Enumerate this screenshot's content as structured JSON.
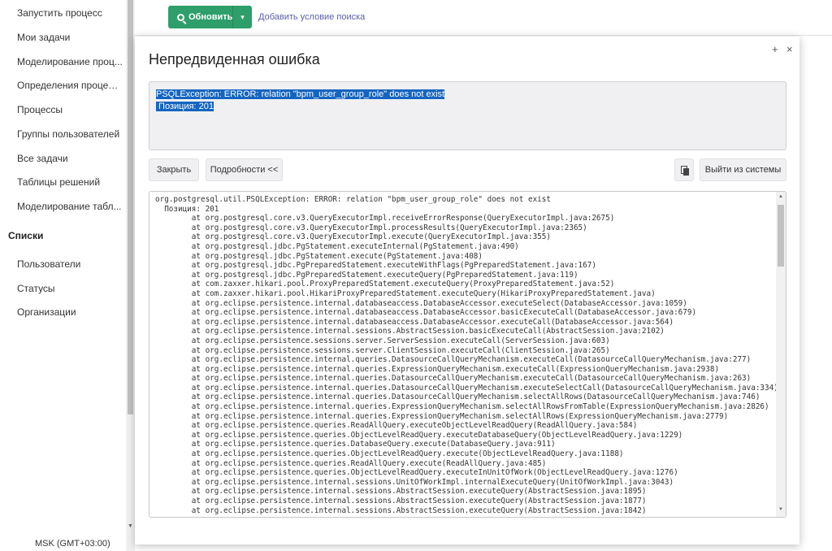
{
  "sidebar": {
    "items": [
      "Запустить процесс",
      "Мои задачи",
      "Моделирование проц...",
      "Определения процесс...",
      "Процессы",
      "Группы пользователей",
      "Все задачи",
      "Таблицы решений",
      "Моделирование табл..."
    ],
    "section": "Списки",
    "list_items": [
      "Пользователи",
      "Статусы",
      "Организации"
    ],
    "timezone": "MSK (GMT+03:00)"
  },
  "toolbar": {
    "refresh_label": "Обновить",
    "add_condition": "Добавить условие поиска"
  },
  "modal": {
    "title": "Непредвиденная ошибка",
    "maximize": "+",
    "close": "×",
    "message_line1": "PSQLException: ERROR: relation \"bpm_user_group_role\" does not exist",
    "message_line2": " Позиция: 201",
    "close_button": "Закрыть",
    "details_button": "Подробности <<",
    "logout_button": "Выйти из системы",
    "stacktrace": "org.postgresql.util.PSQLException: ERROR: relation \"bpm_user_group_role\" does not exist\n  Позиция: 201\n\tat org.postgresql.core.v3.QueryExecutorImpl.receiveErrorResponse(QueryExecutorImpl.java:2675)\n\tat org.postgresql.core.v3.QueryExecutorImpl.processResults(QueryExecutorImpl.java:2365)\n\tat org.postgresql.core.v3.QueryExecutorImpl.execute(QueryExecutorImpl.java:355)\n\tat org.postgresql.jdbc.PgStatement.executeInternal(PgStatement.java:490)\n\tat org.postgresql.jdbc.PgStatement.execute(PgStatement.java:408)\n\tat org.postgresql.jdbc.PgPreparedStatement.executeWithFlags(PgPreparedStatement.java:167)\n\tat org.postgresql.jdbc.PgPreparedStatement.executeQuery(PgPreparedStatement.java:119)\n\tat com.zaxxer.hikari.pool.ProxyPreparedStatement.executeQuery(ProxyPreparedStatement.java:52)\n\tat com.zaxxer.hikari.pool.HikariProxyPreparedStatement.executeQuery(HikariProxyPreparedStatement.java)\n\tat org.eclipse.persistence.internal.databaseaccess.DatabaseAccessor.executeSelect(DatabaseAccessor.java:1059)\n\tat org.eclipse.persistence.internal.databaseaccess.DatabaseAccessor.basicExecuteCall(DatabaseAccessor.java:679)\n\tat org.eclipse.persistence.internal.databaseaccess.DatabaseAccessor.executeCall(DatabaseAccessor.java:564)\n\tat org.eclipse.persistence.internal.sessions.AbstractSession.basicExecuteCall(AbstractSession.java:2102)\n\tat org.eclipse.persistence.sessions.server.ServerSession.executeCall(ServerSession.java:603)\n\tat org.eclipse.persistence.sessions.server.ClientSession.executeCall(ClientSession.java:265)\n\tat org.eclipse.persistence.internal.queries.DatasourceCallQueryMechanism.executeCall(DatasourceCallQueryMechanism.java:277)\n\tat org.eclipse.persistence.internal.queries.ExpressionQueryMechanism.executeCall(ExpressionQueryMechanism.java:2938)\n\tat org.eclipse.persistence.internal.queries.DatasourceCallQueryMechanism.executeCall(DatasourceCallQueryMechanism.java:263)\n\tat org.eclipse.persistence.internal.queries.DatasourceCallQueryMechanism.executeSelectCall(DatasourceCallQueryMechanism.java:334)\n\tat org.eclipse.persistence.internal.queries.DatasourceCallQueryMechanism.selectAllRows(DatasourceCallQueryMechanism.java:746)\n\tat org.eclipse.persistence.internal.queries.ExpressionQueryMechanism.selectAllRowsFromTable(ExpressionQueryMechanism.java:2826)\n\tat org.eclipse.persistence.internal.queries.ExpressionQueryMechanism.selectAllRows(ExpressionQueryMechanism.java:2779)\n\tat org.eclipse.persistence.queries.ReadAllQuery.executeObjectLevelReadQuery(ReadAllQuery.java:584)\n\tat org.eclipse.persistence.queries.ObjectLevelReadQuery.executeDatabaseQuery(ObjectLevelReadQuery.java:1229)\n\tat org.eclipse.persistence.queries.DatabaseQuery.execute(DatabaseQuery.java:911)\n\tat org.eclipse.persistence.queries.ObjectLevelReadQuery.execute(ObjectLevelReadQuery.java:1188)\n\tat org.eclipse.persistence.queries.ReadAllQuery.execute(ReadAllQuery.java:485)\n\tat org.eclipse.persistence.queries.ObjectLevelReadQuery.executeInUnitOfWork(ObjectLevelReadQuery.java:1276)\n\tat org.eclipse.persistence.internal.sessions.UnitOfWorkImpl.internalExecuteQuery(UnitOfWorkImpl.java:3043)\n\tat org.eclipse.persistence.internal.sessions.AbstractSession.executeQuery(AbstractSession.java:1895)\n\tat org.eclipse.persistence.internal.sessions.AbstractSession.executeQuery(AbstractSession.java:1877)\n\tat org.eclipse.persistence.internal.sessions.AbstractSession.executeQuery(AbstractSession.java:1842)"
  },
  "colors": {
    "accent_green": "#2e9f6a",
    "link": "#5b5fa8",
    "selection": "#1565c0"
  }
}
